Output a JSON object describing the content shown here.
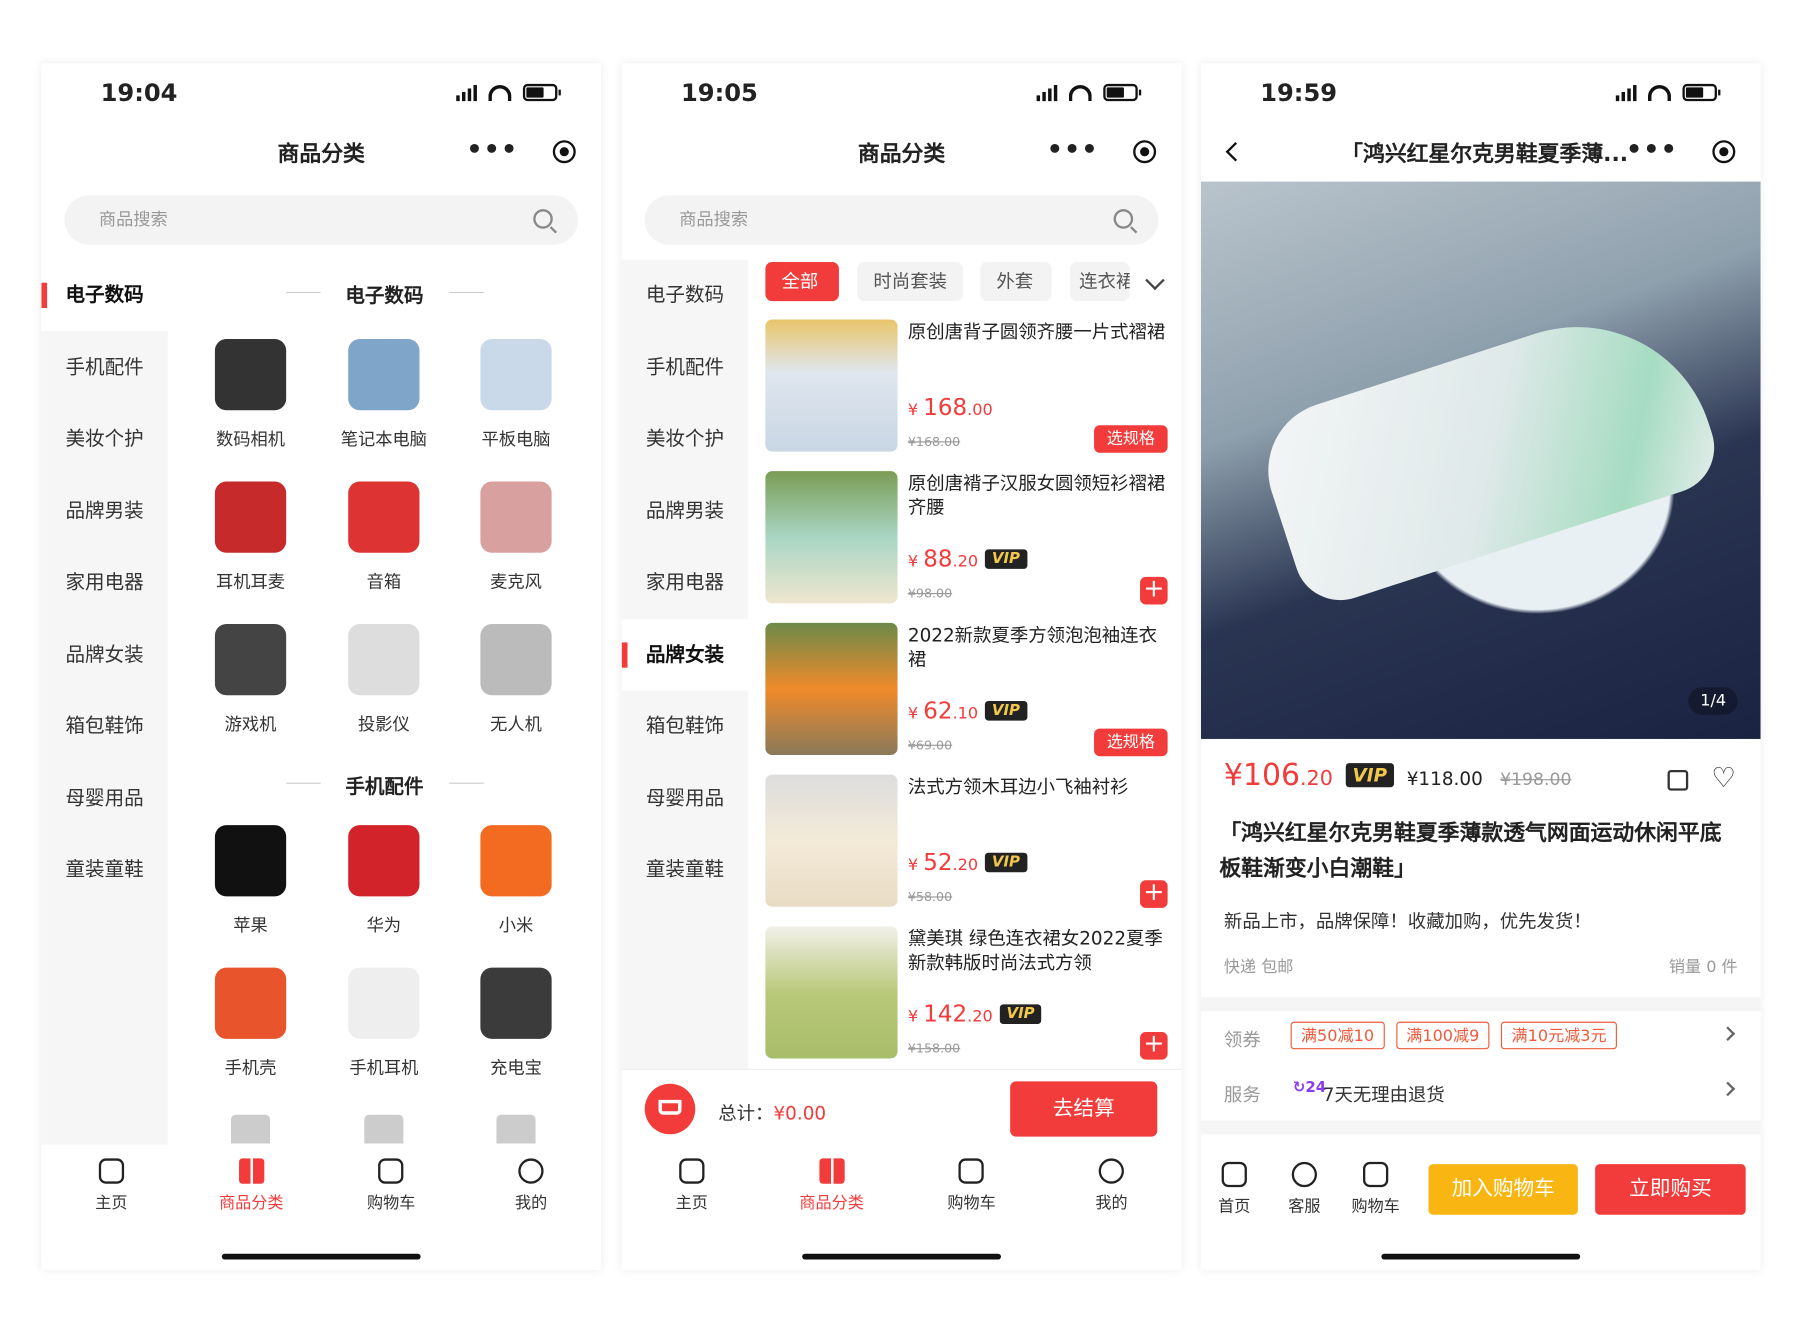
{
  "colors": {
    "accent": "#f23b3b",
    "yellow": "#f9b512",
    "vip_bg": "#222222"
  },
  "status": {
    "time1": "19:04",
    "time2": "19:05",
    "time3": "19:59"
  },
  "nav": {
    "title": "商品分类",
    "more": "•••"
  },
  "search": {
    "placeholder": "商品搜索"
  },
  "sidebar": [
    "电子数码",
    "手机配件",
    "美妆个护",
    "品牌男装",
    "家用电器",
    "品牌女装",
    "箱包鞋饰",
    "母婴用品",
    "童装童鞋"
  ],
  "screen1": {
    "active_index": 0,
    "sections": [
      {
        "title": "电子数码",
        "items": [
          {
            "label": "数码相机",
            "color": "#333"
          },
          {
            "label": "笔记本电脑",
            "color": "#7fa6c8"
          },
          {
            "label": "平板电脑",
            "color": "#c9d9ea"
          },
          {
            "label": "耳机耳麦",
            "color": "#c62a2a"
          },
          {
            "label": "音箱",
            "color": "#d33"
          },
          {
            "label": "麦克风",
            "color": "#d9a0a0"
          },
          {
            "label": "游戏机",
            "color": "#444"
          },
          {
            "label": "投影仪",
            "color": "#ddd"
          },
          {
            "label": "无人机",
            "color": "#bbb"
          }
        ]
      },
      {
        "title": "手机配件",
        "items": [
          {
            "label": "苹果",
            "color": "#111"
          },
          {
            "label": "华为",
            "color": "#d2232a"
          },
          {
            "label": "小米",
            "color": "#f26b20"
          },
          {
            "label": "手机壳",
            "color": "#e8542b"
          },
          {
            "label": "手机耳机",
            "color": "#eee"
          },
          {
            "label": "充电宝",
            "color": "#3b3b3b"
          }
        ]
      }
    ]
  },
  "screen2": {
    "active_index": 5,
    "chips": [
      "全部",
      "时尚套装",
      "外套",
      "连衣裙"
    ],
    "products": [
      {
        "title": "原创唐背子圆领齐腰一片式褶裙",
        "price_int": "168",
        "price_dec": ".00",
        "vip": false,
        "old": "¥168.00",
        "action": "选规格",
        "img": "linear-gradient(#e9c56a,#dfe6ee 40%,#c9d6e4)"
      },
      {
        "title": "原创唐褙子汉服女圆领短衫褶裙齐腰",
        "price_int": "88",
        "price_dec": ".20",
        "vip": true,
        "old": "¥98.00",
        "action": "+",
        "img": "linear-gradient(#7a9c55,#a9d6c4 50%,#efe6cf)"
      },
      {
        "title": "2022新款夏季方领泡泡袖连衣裙",
        "price_int": "62",
        "price_dec": ".10",
        "vip": true,
        "old": "¥69.00",
        "action": "选规格",
        "img": "linear-gradient(#6c8a4a,#f08a2a 50%,#8a7a5a)"
      },
      {
        "title": "法式方领木耳边小飞袖衬衫",
        "price_int": "52",
        "price_dec": ".20",
        "vip": true,
        "old": "¥58.00",
        "action": "+",
        "img": "linear-gradient(#ddd,#f3ead8 50%,#e9dcc5)"
      },
      {
        "title": "黛美琪 绿色连衣裙女2022夏季新款韩版时尚法式方领",
        "price_int": "142",
        "price_dec": ".20",
        "vip": true,
        "old": "¥158.00",
        "action": "+",
        "img": "linear-gradient(#f2f0ea,#b9c97a 50%,#a8bd6a)"
      }
    ],
    "total_label": "总计：",
    "total": "¥0.00",
    "checkout": "去结算"
  },
  "vip_label": "VIP",
  "tabs": [
    "主页",
    "商品分类",
    "购物车",
    "我的"
  ],
  "screen3": {
    "title": "「鸿兴红星尔克男鞋夏季薄...",
    "image_index": "1/4",
    "price_int": "¥106",
    "price_dec": ".20",
    "member_price": "¥118.00",
    "old_price": "¥198.00",
    "product_title": "「鸿兴红星尔克男鞋夏季薄款透气网面运动休闲平底板鞋渐变小白潮鞋」",
    "desc": "新品上市，品牌保障！收藏加购，优先发货！",
    "shipping": "快递 包邮",
    "sales": "销量 0 件",
    "coupon_label": "领券",
    "coupons": [
      "满50减10",
      "满100减9",
      "满10元减3元"
    ],
    "service_label": "服务",
    "service": "7天无理由退货",
    "bottom": {
      "home": "首页",
      "service": "客服",
      "cart": "购物车",
      "add_cart": "加入购物车",
      "buy": "立即购买"
    }
  }
}
